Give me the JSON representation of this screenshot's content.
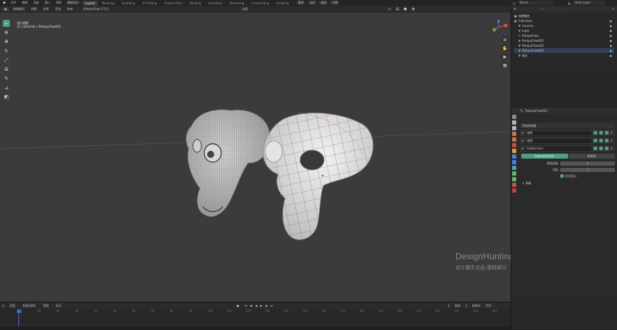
{
  "topbar": {
    "menus": [
      "文件",
      "编辑",
      "渲染",
      "窗口",
      "帮助"
    ],
    "mode_pill": "重新拓扑",
    "workspaces": [
      "Layout",
      "Modeling",
      "Sculpting",
      "UV Editing",
      "Texture Paint",
      "Shading",
      "Animation",
      "Rendering",
      "Compositing",
      "Scripting"
    ],
    "active_workspace": "Layout",
    "right_pills": [
      "重建",
      "全局",
      "变换",
      "布置"
    ],
    "scene_label": "Scene",
    "view_layer_label": "View Layer"
  },
  "viewport_header": {
    "mode": "物体模式",
    "menus": [
      "视图",
      "选择",
      "添加",
      "物体"
    ],
    "addon_label": "RetopoFlow 3.1.0",
    "orientation": "全局"
  },
  "viewport": {
    "view_name": "用户透视",
    "collection_info": "(1) Collection | RetopoFlow003",
    "watermark_en": "DesignHunting",
    "watermark_cn": "设计捕手出品-基础部分"
  },
  "toolbar_icons": [
    "select-box-icon",
    "cursor-icon",
    "move-icon",
    "rotate-icon",
    "scale-icon",
    "transform-icon",
    "annotate-icon",
    "measure-icon",
    "add-cube-icon"
  ],
  "outliner": {
    "title": "场景集合",
    "items": [
      {
        "name": "Collection",
        "color": "#bcbcbc",
        "selected": false,
        "indent": 0
      },
      {
        "name": "Camera",
        "color": "#e2a45b",
        "selected": false,
        "indent": 1
      },
      {
        "name": "Light",
        "color": "#e2a45b",
        "selected": false,
        "indent": 1
      },
      {
        "name": "RetopoFlow",
        "color": "#6a6a6a",
        "selected": false,
        "indent": 1
      },
      {
        "name": "RetopoFlow001",
        "color": "#e2a45b",
        "selected": false,
        "indent": 1
      },
      {
        "name": "RetopoFlow002",
        "color": "#e2a45b",
        "selected": false,
        "indent": 1
      },
      {
        "name": "RetopoFlow003",
        "color": "#e2a45b",
        "selected": true,
        "indent": 1
      },
      {
        "name": "猴头",
        "color": "#e2a45b",
        "selected": false,
        "indent": 1
      }
    ]
  },
  "properties": {
    "object_name": "RetopoFlow003",
    "add_modifier": "添加修改器",
    "modifiers": [
      {
        "name": "镜像"
      },
      {
        "name": "表面"
      },
      {
        "name": "Subdivision"
      }
    ],
    "subdiv_tabs": [
      "Catmull-Clark",
      "简单型"
    ],
    "levels_viewport_label": "视图层级",
    "levels_viewport": "1",
    "render_label": "渲染",
    "render_value": "2",
    "optimal_display": "优化显示",
    "advanced": "高级"
  },
  "timeline": {
    "menus": [
      "回放",
      "抠像(插帧)",
      "视图",
      "标记"
    ],
    "current_frame": "1",
    "start_label": "起始",
    "start": "1",
    "end_label": "结束点",
    "end": "250",
    "ticks": [
      "0",
      "10",
      "20",
      "30",
      "40",
      "50",
      "60",
      "70",
      "80",
      "90",
      "100",
      "110",
      "120",
      "130",
      "140",
      "150",
      "160",
      "170",
      "180",
      "190",
      "200",
      "210",
      "220",
      "230",
      "240",
      "250"
    ]
  },
  "colors": {
    "accent": "#4f9e86",
    "viewport_bg": "#3c3a3c",
    "selection": "#2f3f55",
    "playhead": "#3f70b8"
  }
}
